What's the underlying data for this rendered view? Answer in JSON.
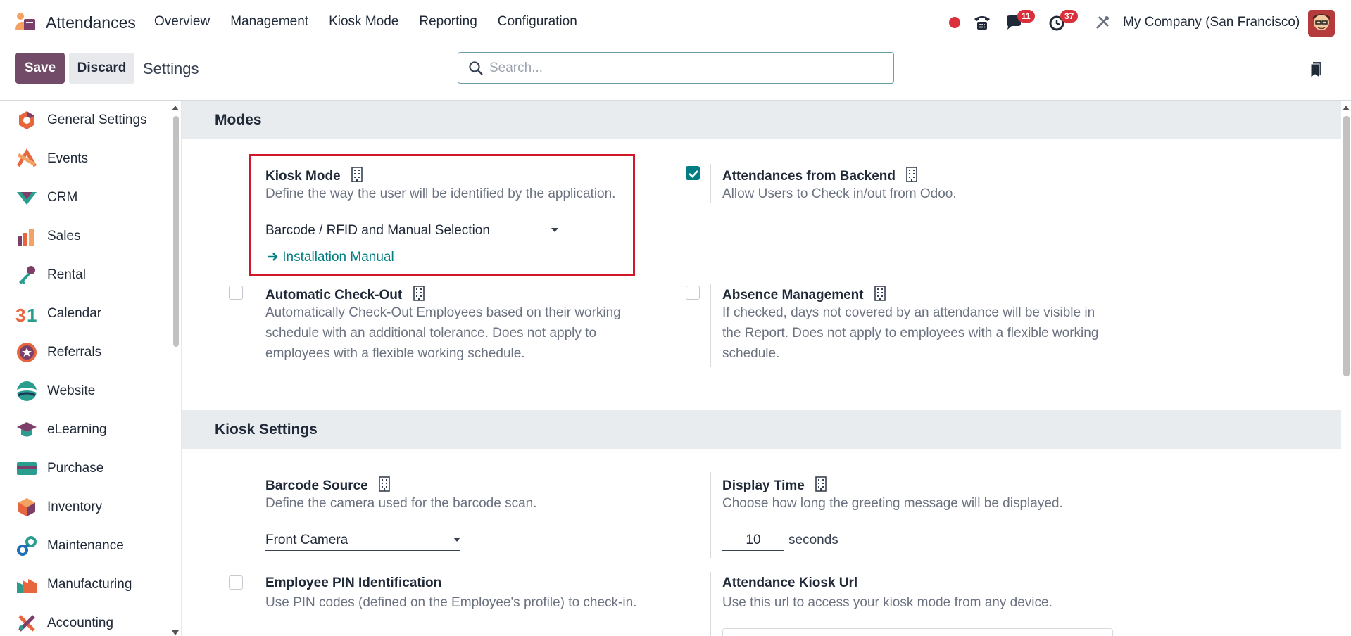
{
  "navbar": {
    "app_name": "Attendances",
    "menu": [
      "Overview",
      "Management",
      "Kiosk Mode",
      "Reporting",
      "Configuration"
    ],
    "messages_count": "11",
    "activities_count": "37",
    "company": "My Company (San Francisco)"
  },
  "control_panel": {
    "save_label": "Save",
    "discard_label": "Discard",
    "breadcrumb": "Settings",
    "search_placeholder": "Search..."
  },
  "sidebar": {
    "items": [
      {
        "label": "General Settings",
        "icon": "general-settings-icon"
      },
      {
        "label": "Events",
        "icon": "events-icon"
      },
      {
        "label": "CRM",
        "icon": "crm-icon"
      },
      {
        "label": "Sales",
        "icon": "sales-icon"
      },
      {
        "label": "Rental",
        "icon": "rental-icon"
      },
      {
        "label": "Calendar",
        "icon": "calendar-icon"
      },
      {
        "label": "Referrals",
        "icon": "referrals-icon"
      },
      {
        "label": "Website",
        "icon": "website-icon"
      },
      {
        "label": "eLearning",
        "icon": "elearning-icon"
      },
      {
        "label": "Purchase",
        "icon": "purchase-icon"
      },
      {
        "label": "Inventory",
        "icon": "inventory-icon"
      },
      {
        "label": "Maintenance",
        "icon": "maintenance-icon"
      },
      {
        "label": "Manufacturing",
        "icon": "manufacturing-icon"
      },
      {
        "label": "Accounting",
        "icon": "accounting-icon"
      }
    ]
  },
  "modes": {
    "title": "Modes",
    "kiosk_mode": {
      "title": "Kiosk Mode",
      "desc": "Define the way the user will be identified by the application.",
      "value": "Barcode / RFID and Manual Selection",
      "link": "Installation Manual"
    },
    "backend": {
      "title": "Attendances from Backend",
      "desc": "Allow Users to Check in/out from Odoo.",
      "checked": true
    },
    "auto_checkout": {
      "title": "Automatic Check-Out",
      "desc_1": "Automatically Check-Out Employees based on their working",
      "desc_2": "schedule with an additional tolerance. Does not apply to",
      "desc_3": "employees with a flexible working schedule.",
      "checked": false
    },
    "absence": {
      "title": "Absence Management",
      "desc_1": "If checked, days not covered by an attendance will be visible in",
      "desc_2": "the Report. Does not apply to employees with a flexible working",
      "desc_3": "schedule.",
      "checked": false
    }
  },
  "kiosk_settings": {
    "title": "Kiosk Settings",
    "barcode_source": {
      "title": "Barcode Source",
      "desc": "Define the camera used for the barcode scan.",
      "value": "Front Camera"
    },
    "display_time": {
      "title": "Display Time",
      "desc": "Choose how long the greeting message will be displayed.",
      "value": "10",
      "unit": "seconds"
    },
    "pin": {
      "title": "Employee PIN Identification",
      "desc": "Use PIN codes (defined on the Employee's profile) to check-in.",
      "checked": false
    },
    "kiosk_url": {
      "title": "Attendance Kiosk Url",
      "desc": "Use this url to access your kiosk mode from any device."
    }
  },
  "colors": {
    "brand": "#714b67",
    "accent": "#017e84",
    "badge": "#d9303b",
    "highlight": "#d0182a"
  }
}
